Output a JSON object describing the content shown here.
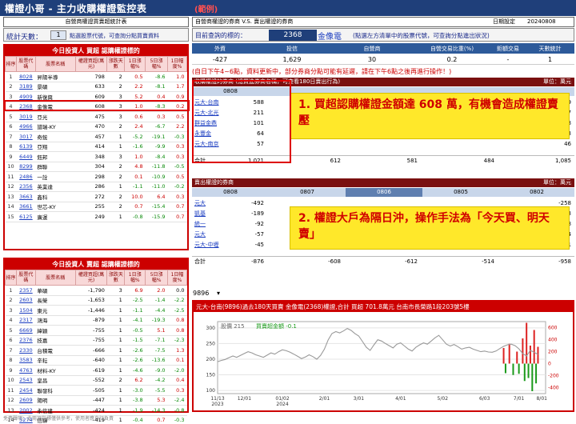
{
  "title": "權證小哥 - 主力收購權證監控表",
  "badge": "(範例)",
  "left": {
    "header": "自營商權證買賣超統計表",
    "filter_label": "統計天數：",
    "filter_value": "1",
    "filter_hint": "點選股票代號，可查詢分點買賣資料",
    "buy_caption": "今日投資人 買超 認購權證標的",
    "sell_caption": "今日投資人 賣超 認購權證標的",
    "columns": [
      "排序",
      "股票代碼",
      "股票名稱",
      "權證買超(萬元)",
      "漲跌天數",
      "1日漲幅%",
      "5日漲幅%",
      "1日幅度%"
    ],
    "buy_rows": [
      [
        "1",
        "8028",
        "昇陽半導",
        "798",
        "2",
        "0.5",
        "-8.6",
        "1.0"
      ],
      [
        "2",
        "3189",
        "景碩",
        "633",
        "2",
        "2.2",
        "-8.1",
        "1.7"
      ],
      [
        "3",
        "4909",
        "新復興",
        "609",
        "3",
        "5.2",
        "0.4",
        "0.9"
      ],
      [
        "4",
        "2368",
        "金像電",
        "608",
        "3",
        "1.0",
        "-8.3",
        "0.2"
      ],
      [
        "5",
        "3019",
        "亞光",
        "475",
        "3",
        "0.6",
        "0.3",
        "0.5"
      ],
      [
        "6",
        "4966",
        "譜瑞-KY",
        "470",
        "2",
        "2.4",
        "-6.7",
        "2.2"
      ],
      [
        "7",
        "3017",
        "奇鋐",
        "457",
        "1",
        "-5.2",
        "-19.1",
        "-0.3"
      ],
      [
        "8",
        "6139",
        "亞翔",
        "414",
        "1",
        "-1.6",
        "-9.9",
        "0.3"
      ],
      [
        "9",
        "6449",
        "鈺邦",
        "348",
        "3",
        "1.0",
        "-8.4",
        "0.3"
      ],
      [
        "10",
        "8299",
        "群聯",
        "304",
        "2",
        "4.8",
        "-11.8",
        "-0.5"
      ],
      [
        "11",
        "2486",
        "一詮",
        "298",
        "2",
        "0.1",
        "-10.9",
        "0.5"
      ],
      [
        "12",
        "2356",
        "英業達",
        "286",
        "1",
        "-1.1",
        "-11.0",
        "-0.2"
      ],
      [
        "13",
        "3663",
        "鑫科",
        "272",
        "2",
        "10.0",
        "6.4",
        "0.3"
      ],
      [
        "14",
        "3661",
        "世芯-KY",
        "255",
        "2",
        "0.7",
        "-15.4",
        "0.7"
      ],
      [
        "15",
        "6125",
        "廣運",
        "249",
        "1",
        "-0.8",
        "-15.9",
        "0.7"
      ]
    ],
    "sell_rows": [
      [
        "1",
        "2357",
        "華碩",
        "-1,790",
        "3",
        "6.9",
        "2.0",
        "0.0"
      ],
      [
        "2",
        "2603",
        "長榮",
        "-1,653",
        "1",
        "-2.5",
        "-1.4",
        "-2.2"
      ],
      [
        "3",
        "1504",
        "東元",
        "-1,446",
        "1",
        "-1.1",
        "-4.4",
        "-2.5"
      ],
      [
        "4",
        "2317",
        "鴻海",
        "-879",
        "1",
        "-4.1",
        "-19.3",
        "0.8"
      ],
      [
        "5",
        "6669",
        "緯穎",
        "-755",
        "1",
        "-0.5",
        "5.1",
        "0.8"
      ],
      [
        "6",
        "2376",
        "技嘉",
        "-755",
        "1",
        "-1.5",
        "-7.1",
        "-2.3"
      ],
      [
        "7",
        "2330",
        "台積電",
        "-666",
        "1",
        "-2.6",
        "-7.5",
        "1.3"
      ],
      [
        "8",
        "3583",
        "辛耘",
        "-640",
        "1",
        "-2.6",
        "-13.6",
        "0.1"
      ],
      [
        "9",
        "4763",
        "材料-KY",
        "-619",
        "1",
        "-4.6",
        "-9.0",
        "-2.0"
      ],
      [
        "10",
        "2543",
        "皇昌",
        "-552",
        "2",
        "6.2",
        "-4.2",
        "0.4"
      ],
      [
        "11",
        "2454",
        "聯發科",
        "-505",
        "1",
        "-3.0",
        "-5.5",
        "0.3"
      ],
      [
        "12",
        "2609",
        "陽明",
        "-447",
        "1",
        "-3.8",
        "5.3",
        "-2.4"
      ],
      [
        "13",
        "2002",
        "永信建",
        "-424",
        "1",
        "-1.9",
        "-14.3",
        "-0.8"
      ],
      [
        "14",
        "5274",
        "信驊",
        "-419",
        "1",
        "-0.4",
        "0.7",
        "-0.3"
      ],
      [
        "15",
        "2439",
        "創意",
        "-393",
        "1",
        "-1.7",
        "-12.5",
        "-0.2"
      ]
    ]
  },
  "right": {
    "top_title": "自營商權證的券商 V.S. 賣出權證的券商",
    "date_label": "日期設定",
    "date_value": "20240808",
    "stock_label": "目前查詢的標的：",
    "stock_code": "2368",
    "stock_name": "金像電",
    "stock_hint": "(點選左方清單中的股票代號，可查詢分點進出狀況)",
    "summary_headers": [
      "外資",
      "投信",
      "自營商",
      "自營交易比重(%)",
      "鉅額交易",
      "天數統計"
    ],
    "summary_values": [
      "-427",
      "1,629",
      "30",
      "0.2",
      "-",
      "1"
    ],
    "note": "(自日下午4~6點，資料更新中，部分券商分點可能有延遲，請在下午6點之後再進行操作！)",
    "buy_block_title": "收購權證的券商 (總買進券商名稱，可查看180日賣出行為)",
    "sell_block_title": "賣出權證的券商",
    "unit": "單位：萬元",
    "dates": [
      "0808",
      "0807",
      "0806",
      "0805",
      "0802"
    ],
    "buy_brokers": [
      [
        "元大-台南",
        "588"
      ],
      [
        "元大-北光",
        "211"
      ],
      [
        "群益金鼎",
        "101"
      ],
      [
        "永豐金",
        "64"
      ],
      [
        "元大-南京",
        "57"
      ]
    ],
    "buy_right_cols": [
      [
        "群益金鼎",
        "35",
        "群益金鼎-敦",
        "21",
        "元大-中壢",
        "14",
        "凱基-鳳山",
        "13"
      ]
    ],
    "buy_right_vals": [
      "739",
      "177",
      "58",
      "53",
      "46"
    ],
    "buy_totals": [
      "1,021",
      "612",
      "581",
      "484",
      "1,085"
    ],
    "sell_brokers": [
      [
        "元大",
        "-492"
      ],
      [
        "凱基",
        "-189"
      ],
      [
        "統一",
        "-92"
      ],
      [
        "元大",
        "-57"
      ],
      [
        "元大-中壢",
        "-45"
      ]
    ],
    "sell_right_vals": [
      "-258",
      "-173",
      "-138",
      "-94",
      "-81"
    ],
    "sell_totals": [
      "-876",
      "-608",
      "-612",
      "-514",
      "-958"
    ],
    "callout1": "1. 買超認購權證金額達 608 萬，有機會造成權證賣壓",
    "callout2": "2.  權證大戶為隔日沖，操作手法為「今天買、明天賣」",
    "dropdown_value": "9896",
    "chart_title": "元大-台南(9896)過去180天買賣 金像電(2368)權證,合計  買超 701.8萬元  台南市長榮路1段203號5樓"
  },
  "chart_data": {
    "type": "line",
    "title": "元大-台南(9896)過去180天買賣 金像電(2368)權證,合計 買超 701.8萬元",
    "legend": [
      "股價 215",
      "買賣超金額 -0.1"
    ],
    "x_ticks": [
      "11/13\n2023",
      "12/01",
      "01/02\n2024",
      "2/01",
      "3/01",
      "4/01",
      "5/02",
      "6/03",
      "7/01",
      "8/01"
    ],
    "y_left_ticks": [
      100,
      150,
      200,
      250,
      300
    ],
    "y_right_ticks": [
      -400,
      -200,
      0,
      200,
      400,
      600
    ],
    "ylim_left": [
      90,
      320
    ],
    "ylim_right": [
      -500,
      700
    ],
    "price_series": [
      [
        0,
        192
      ],
      [
        2,
        196
      ],
      [
        4,
        199
      ],
      [
        6,
        205
      ],
      [
        8,
        210
      ],
      [
        10,
        206
      ],
      [
        12,
        212
      ],
      [
        14,
        218
      ],
      [
        16,
        224
      ],
      [
        18,
        220
      ],
      [
        20,
        214
      ],
      [
        22,
        210
      ],
      [
        24,
        206
      ],
      [
        26,
        213
      ],
      [
        28,
        220
      ],
      [
        30,
        216
      ],
      [
        32,
        224
      ],
      [
        34,
        230
      ],
      [
        36,
        227
      ],
      [
        38,
        222
      ],
      [
        40,
        216
      ],
      [
        42,
        209
      ],
      [
        44,
        202
      ],
      [
        46,
        207
      ],
      [
        48,
        214
      ],
      [
        50,
        208
      ],
      [
        52,
        200
      ],
      [
        54,
        212
      ],
      [
        56,
        232
      ],
      [
        58,
        262
      ],
      [
        60,
        282
      ],
      [
        62,
        288
      ],
      [
        64,
        284
      ],
      [
        66,
        290
      ],
      [
        68,
        298
      ],
      [
        70,
        292
      ],
      [
        72,
        282
      ],
      [
        74,
        274
      ],
      [
        76,
        256
      ],
      [
        78,
        238
      ],
      [
        80,
        228
      ],
      [
        82,
        246
      ],
      [
        84,
        262
      ],
      [
        86,
        258
      ],
      [
        88,
        250
      ],
      [
        90,
        243
      ],
      [
        92,
        236
      ],
      [
        94,
        248
      ],
      [
        96,
        252
      ],
      [
        98,
        242
      ],
      [
        100,
        232
      ],
      [
        102,
        226
      ],
      [
        104,
        238
      ],
      [
        106,
        246
      ],
      [
        108,
        252
      ],
      [
        110,
        248
      ],
      [
        112,
        258
      ],
      [
        114,
        268
      ],
      [
        116,
        276
      ],
      [
        118,
        262
      ],
      [
        120,
        248
      ],
      [
        122,
        242
      ],
      [
        124,
        247
      ],
      [
        126,
        240
      ],
      [
        128,
        232
      ],
      [
        130,
        236
      ],
      [
        132,
        238
      ],
      [
        134,
        232
      ],
      [
        136,
        228
      ],
      [
        138,
        224
      ],
      [
        140,
        226
      ],
      [
        142,
        223
      ],
      [
        144,
        222
      ],
      [
        146,
        226
      ],
      [
        148,
        234
      ],
      [
        150,
        241
      ],
      [
        152,
        246
      ],
      [
        154,
        248
      ],
      [
        156,
        243
      ],
      [
        158,
        233
      ],
      [
        160,
        218
      ],
      [
        162,
        210
      ],
      [
        164,
        228
      ],
      [
        166,
        222
      ],
      [
        168,
        215
      ]
    ],
    "flow_series": [
      [
        150,
        260
      ],
      [
        151,
        -160
      ],
      [
        153,
        330
      ],
      [
        155,
        -190
      ],
      [
        157,
        200
      ],
      [
        158,
        -170
      ],
      [
        160,
        420
      ],
      [
        161,
        -290
      ],
      [
        162,
        680
      ],
      [
        163,
        -240
      ],
      [
        164,
        300
      ],
      [
        165,
        -460
      ],
      [
        166,
        560
      ],
      [
        167,
        -330
      ],
      [
        168,
        280
      ]
    ]
  }
}
